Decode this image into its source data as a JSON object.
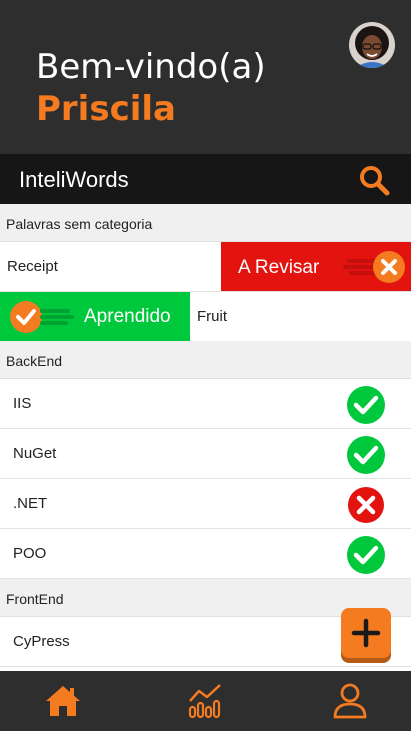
{
  "header": {
    "welcome": "Bem-vindo(a)",
    "username": "Priscila"
  },
  "appbar": {
    "title": "InteliWords"
  },
  "colors": {
    "accent": "#f47b20",
    "dark": "#2e2e2e",
    "learned": "#00c83c",
    "review": "#e31410"
  },
  "sections": [
    {
      "title": "Palavras sem categoria",
      "rows": [
        {
          "word": "Receipt",
          "swipe": "left",
          "action_label": "A Revisar",
          "action_icon": "close-icon"
        },
        {
          "word": "Fruit",
          "swipe": "right",
          "action_label": "Aprendido",
          "action_icon": "check-icon"
        }
      ]
    },
    {
      "title": "BackEnd",
      "rows": [
        {
          "word": "IIS",
          "status": "learned"
        },
        {
          "word": "NuGet",
          "status": "learned"
        },
        {
          "word": ".NET",
          "status": "review"
        },
        {
          "word": "POO",
          "status": "learned"
        }
      ]
    },
    {
      "title": "FrontEnd",
      "rows": [
        {
          "word": "CyPress"
        }
      ]
    }
  ],
  "fab": {
    "icon": "plus-icon"
  },
  "bottom_nav": [
    {
      "icon": "home-icon",
      "active": true
    },
    {
      "icon": "chart-icon",
      "active": false
    },
    {
      "icon": "profile-icon",
      "active": false
    }
  ]
}
